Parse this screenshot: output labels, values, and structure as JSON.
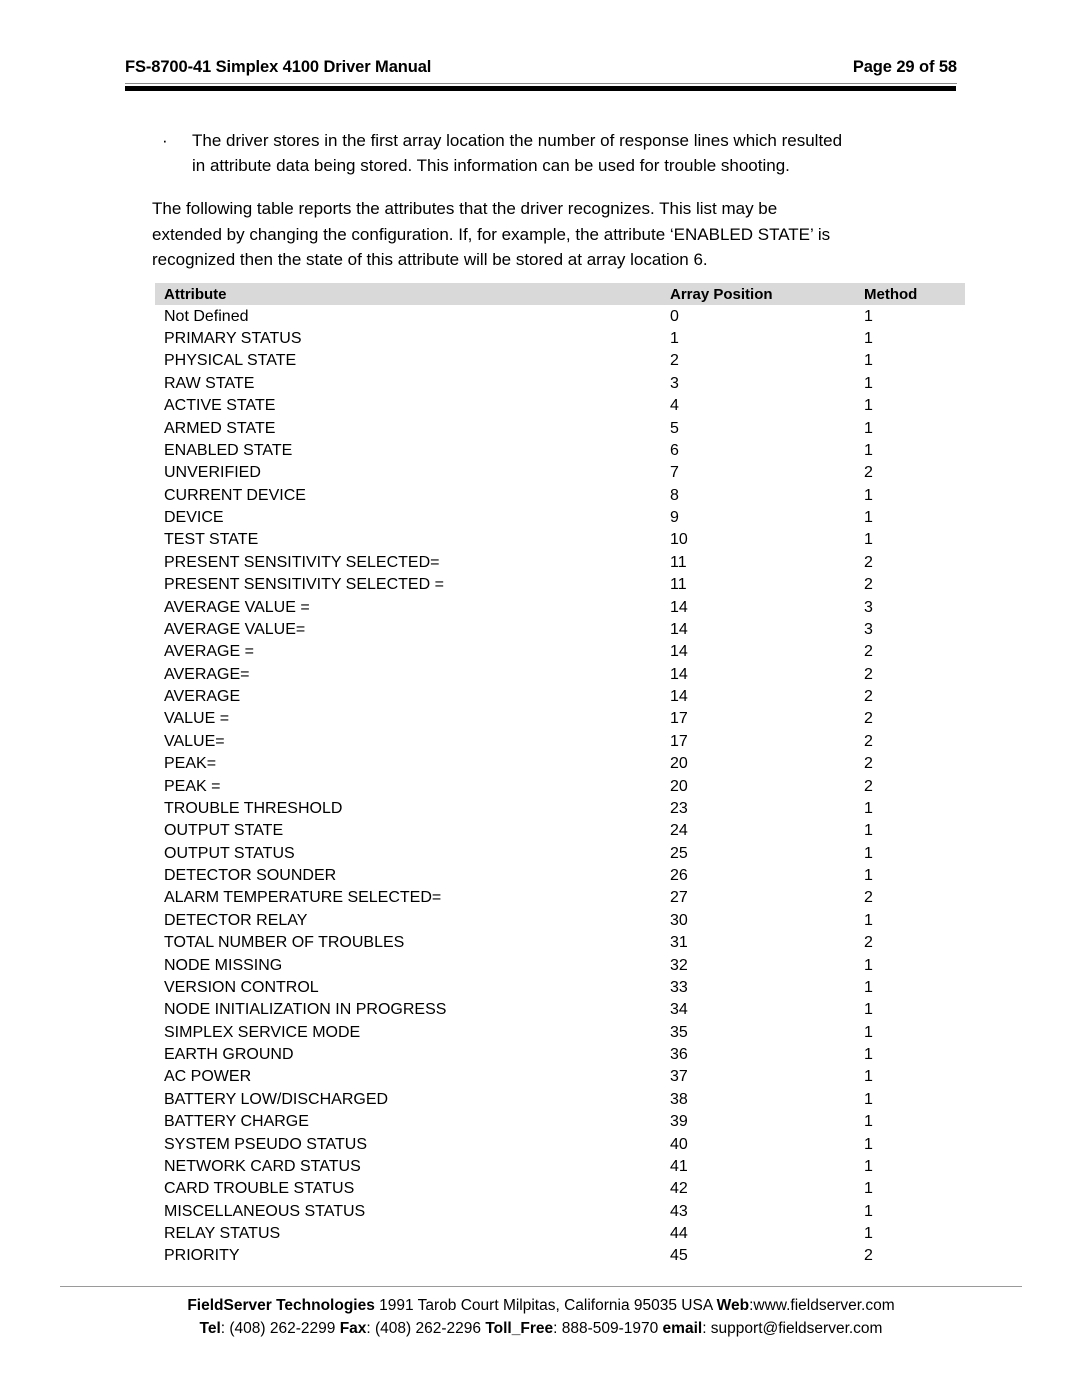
{
  "header": {
    "title": "FS-8700-41 Simplex 4100 Driver Manual",
    "page_label": "Page 29 of 58"
  },
  "body": {
    "bullet": {
      "marker": "·",
      "line1": "The driver stores in the first array location the number of response lines which resulted",
      "line2": "in attribute data being stored.  This information can be used for trouble shooting."
    },
    "paragraph": {
      "line1": "The following table reports the attributes that the driver recognizes. This list may be",
      "line2": "extended by changing the configuration.  If, for example, the attribute ‘ENABLED STATE’ is",
      "line3": "recognized then the state of this attribute will be stored at array location 6."
    }
  },
  "table": {
    "columns": [
      "Attribute",
      "Array Position",
      "Method"
    ],
    "rows": [
      [
        "Not Defined",
        "0",
        "1"
      ],
      [
        "PRIMARY STATUS",
        "1",
        "1"
      ],
      [
        "PHYSICAL STATE",
        "2",
        "1"
      ],
      [
        "RAW STATE",
        "3",
        "1"
      ],
      [
        "ACTIVE STATE",
        "4",
        "1"
      ],
      [
        "ARMED STATE",
        "5",
        "1"
      ],
      [
        "ENABLED STATE",
        "6",
        "1"
      ],
      [
        "UNVERIFIED",
        "7",
        "2"
      ],
      [
        "CURRENT DEVICE",
        "8",
        "1"
      ],
      [
        "DEVICE",
        "9",
        "1"
      ],
      [
        "TEST STATE",
        "10",
        "1"
      ],
      [
        "PRESENT SENSITIVITY SELECTED=",
        "11",
        "2"
      ],
      [
        "PRESENT SENSITIVITY SELECTED =",
        "11",
        "2"
      ],
      [
        "AVERAGE VALUE =",
        "14",
        "3"
      ],
      [
        "AVERAGE VALUE=",
        "14",
        "3"
      ],
      [
        "AVERAGE =",
        "14",
        "2"
      ],
      [
        "AVERAGE=",
        "14",
        "2"
      ],
      [
        "AVERAGE",
        "14",
        "2"
      ],
      [
        "VALUE =",
        "17",
        "2"
      ],
      [
        "VALUE=",
        "17",
        "2"
      ],
      [
        "PEAK=",
        "20",
        "2"
      ],
      [
        "PEAK =",
        "20",
        "2"
      ],
      [
        "TROUBLE THRESHOLD",
        "23",
        "1"
      ],
      [
        "OUTPUT STATE",
        "24",
        "1"
      ],
      [
        "OUTPUT STATUS",
        "25",
        "1"
      ],
      [
        "DETECTOR SOUNDER",
        "26",
        "1"
      ],
      [
        "ALARM TEMPERATURE SELECTED=",
        "27",
        "2"
      ],
      [
        "DETECTOR RELAY",
        "30",
        "1"
      ],
      [
        "TOTAL NUMBER OF TROUBLES",
        "31",
        "2"
      ],
      [
        "NODE MISSING",
        "32",
        "1"
      ],
      [
        "VERSION CONTROL",
        "33",
        "1"
      ],
      [
        "NODE INITIALIZATION IN PROGRESS",
        "34",
        "1"
      ],
      [
        "SIMPLEX SERVICE MODE",
        "35",
        "1"
      ],
      [
        "EARTH GROUND",
        "36",
        "1"
      ],
      [
        "AC POWER",
        "37",
        "1"
      ],
      [
        "BATTERY LOW/DISCHARGED",
        "38",
        "1"
      ],
      [
        "BATTERY CHARGE",
        "39",
        "1"
      ],
      [
        "SYSTEM PSEUDO STATUS",
        "40",
        "1"
      ],
      [
        "NETWORK CARD STATUS",
        "41",
        "1"
      ],
      [
        "CARD TROUBLE STATUS",
        "42",
        "1"
      ],
      [
        "MISCELLANEOUS STATUS",
        "43",
        "1"
      ],
      [
        "RELAY STATUS",
        "44",
        "1"
      ],
      [
        "PRIORITY",
        "45",
        "2"
      ]
    ]
  },
  "footer": {
    "company": "FieldServer Technologies",
    "address": " 1991 Tarob Court Milpitas, California 95035 USA  ",
    "web_label": "Web",
    "web_value": ":www.fieldserver.com",
    "tel_label": "Tel",
    "tel_value": ": (408) 262-2299  ",
    "fax_label": "Fax",
    "fax_value": ": (408) 262-2296  ",
    "tollfree_label": "Toll_Free",
    "tollfree_value": ": 888-509-1970  ",
    "email_label": "email",
    "email_value": ": support@fieldserver.com"
  },
  "colors": {
    "header_band": "#d9d9d9",
    "rule_dark": "#000000",
    "rule_light": "#9a9a9a",
    "text": "#000000"
  }
}
